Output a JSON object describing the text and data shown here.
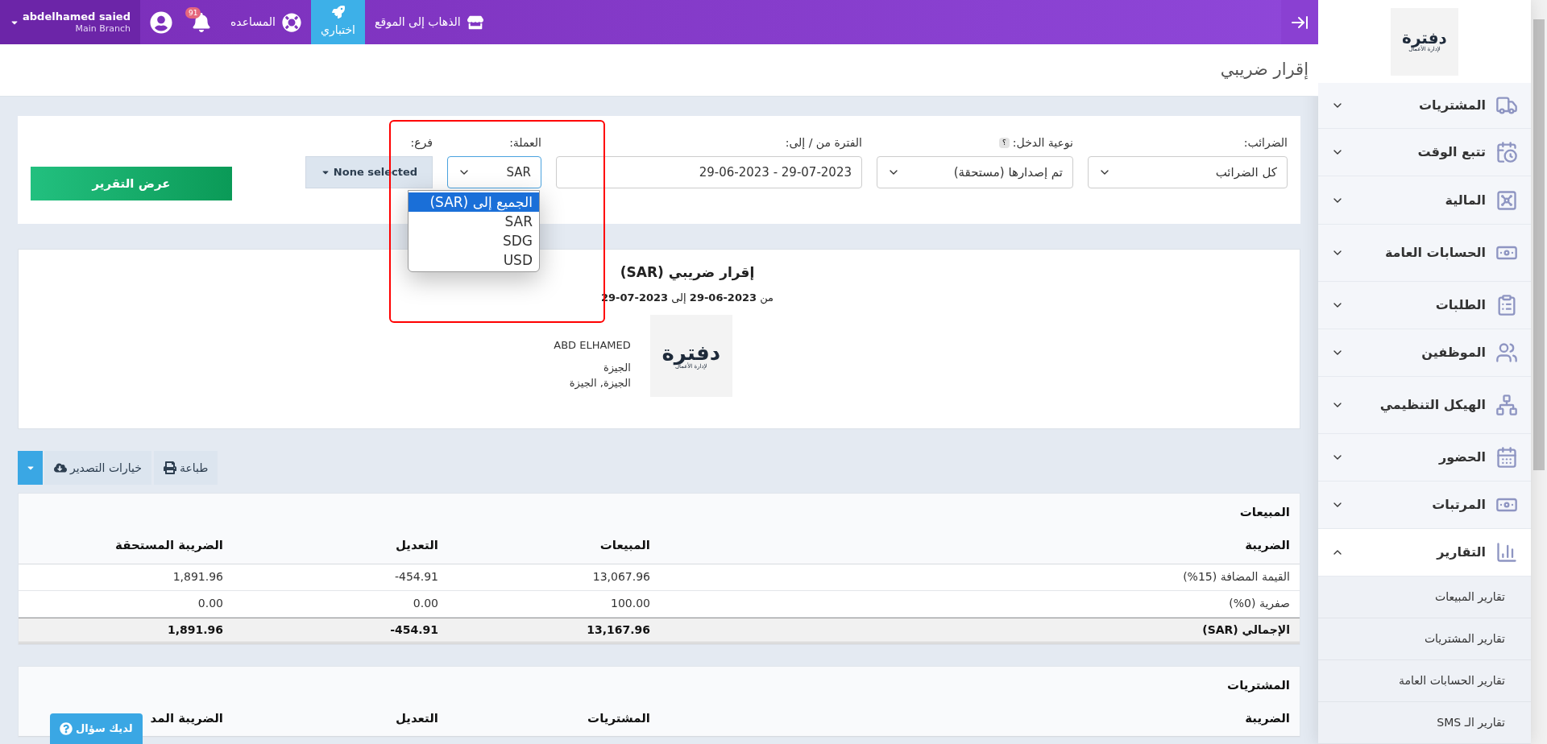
{
  "topbar": {
    "user_name": "abdelhamed saied",
    "branch": "Main Branch",
    "notifications_count": "91",
    "help_label": "المساعده",
    "items": [
      {
        "label": "اختباري",
        "selected": true
      },
      {
        "label": "الذهاب إلى الموقع",
        "selected": false
      }
    ]
  },
  "page_title": "إقرار ضريبي",
  "filters": [
    {
      "kind": "select",
      "label": "الضرائب:",
      "value": "كل الضرائب"
    },
    {
      "kind": "select",
      "label": "نوعية الدخل:",
      "hint": "؟",
      "value": "تم إصدارها (مستحقة)"
    },
    {
      "kind": "input",
      "label": "الفترة من / إلى:",
      "value": "29-06-2023 - 29-07-2023"
    },
    {
      "kind": "select",
      "label": "العملة:",
      "value": "SAR",
      "open": true
    },
    {
      "kind": "multiselect",
      "label": "فرع:",
      "value": "None selected"
    }
  ],
  "currency_options": [
    {
      "label": "الجميع إلى (SAR)",
      "selected": true
    },
    {
      "label": "SAR",
      "selected": false
    },
    {
      "label": "SDG",
      "selected": false
    },
    {
      "label": "USD",
      "selected": false
    }
  ],
  "submit_label": "عرض التقرير",
  "report": {
    "title": "إقرار ضريبي (SAR)",
    "period": "من **2023-06-29** إلى **2023-07-29**",
    "company": "ABD ELHAMED",
    "address": [
      "الجيزة",
      "الجيزة, الجيزة"
    ]
  },
  "logo": {
    "name": "دفترة",
    "tagline": "لإدارة الأعمال"
  },
  "sidebar_logo": {
    "name": "دفترة",
    "tagline": "لإدارة الأعمال"
  },
  "actions": {
    "export": "خيارات التصدير",
    "print": "طباعة"
  },
  "sales": {
    "title": "المبيعات",
    "columns": [
      "الضريبة",
      "المبيعات",
      "التعديل",
      "الضريبة المستحقة"
    ],
    "rows": [
      [
        "القيمة المضافة (15%)",
        "13,067.96",
        "454.91-",
        "1,891.96"
      ],
      [
        "صفرية (0%)",
        "100.00",
        "0.00",
        "0.00"
      ]
    ],
    "total": [
      "الإجمالي (SAR)",
      "13,167.96",
      "454.91-",
      "1,891.96"
    ]
  },
  "purchases": {
    "title": "المشتريات",
    "columns": [
      "الضريبة",
      "المشتريات",
      "التعديل",
      "الضريبة المد"
    ]
  },
  "help_button": "لديك سؤال",
  "sidebar": {
    "items": [
      {
        "label": "المشتريات",
        "expanded": false
      },
      {
        "label": "تتبع الوقت",
        "expanded": false
      },
      {
        "label": "المالية",
        "expanded": false
      },
      {
        "label": "الحسابات العامة",
        "expanded": false
      },
      {
        "label": "الطلبات",
        "expanded": false
      },
      {
        "label": "الموظفين",
        "expanded": false
      },
      {
        "label": "الهيكل التنظيمي",
        "expanded": false
      },
      {
        "label": "الحضور",
        "expanded": false
      },
      {
        "label": "المرتبات",
        "expanded": false
      },
      {
        "label": "التقارير",
        "expanded": true
      }
    ],
    "subitems": [
      "تقارير المبيعات",
      "تقارير المشتريات",
      "تقارير الحسابات العامة",
      "تقارير الـ SMS"
    ]
  }
}
